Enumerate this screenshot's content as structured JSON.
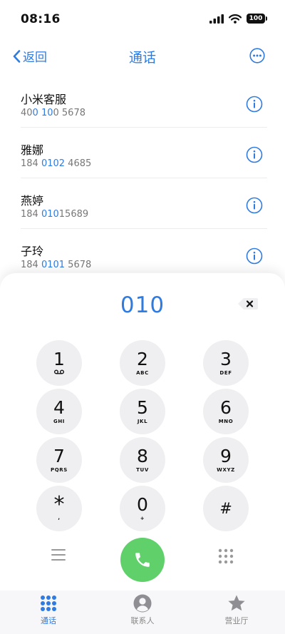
{
  "status_bar": {
    "time": "08:16",
    "battery": "100"
  },
  "nav": {
    "back_label": "返回",
    "title": "通话"
  },
  "contacts": [
    {
      "name": "小米客服",
      "number_parts": [
        "40",
        "0 10",
        "0 5678"
      ]
    },
    {
      "name": "雅娜",
      "number_parts": [
        "184 ",
        "0102",
        " 4685"
      ]
    },
    {
      "name": "燕婷",
      "number_parts": [
        "184 ",
        "010",
        "15689"
      ]
    },
    {
      "name": "子玲",
      "number_parts": [
        "184 ",
        "0101",
        " 5678"
      ]
    }
  ],
  "dialed_number": "010",
  "keypad": [
    {
      "digit": "1",
      "letters": ""
    },
    {
      "digit": "2",
      "letters": "ABC"
    },
    {
      "digit": "3",
      "letters": "DEF"
    },
    {
      "digit": "4",
      "letters": "GHI"
    },
    {
      "digit": "5",
      "letters": "JKL"
    },
    {
      "digit": "6",
      "letters": "MNO"
    },
    {
      "digit": "7",
      "letters": "PQRS"
    },
    {
      "digit": "8",
      "letters": "TUV"
    },
    {
      "digit": "9",
      "letters": "WXYZ"
    },
    {
      "digit": "*",
      "letters": ","
    },
    {
      "digit": "0",
      "letters": "+"
    },
    {
      "digit": "#",
      "letters": ""
    }
  ],
  "tabs": [
    {
      "label": "通话",
      "icon": "keypad-icon",
      "active": true
    },
    {
      "label": "联系人",
      "icon": "person-icon",
      "active": false
    },
    {
      "label": "营业厅",
      "icon": "star-icon",
      "active": false
    }
  ],
  "colors": {
    "accent": "#2f7be0",
    "call_green": "#5fd06a",
    "key_bg": "#efeff1"
  }
}
